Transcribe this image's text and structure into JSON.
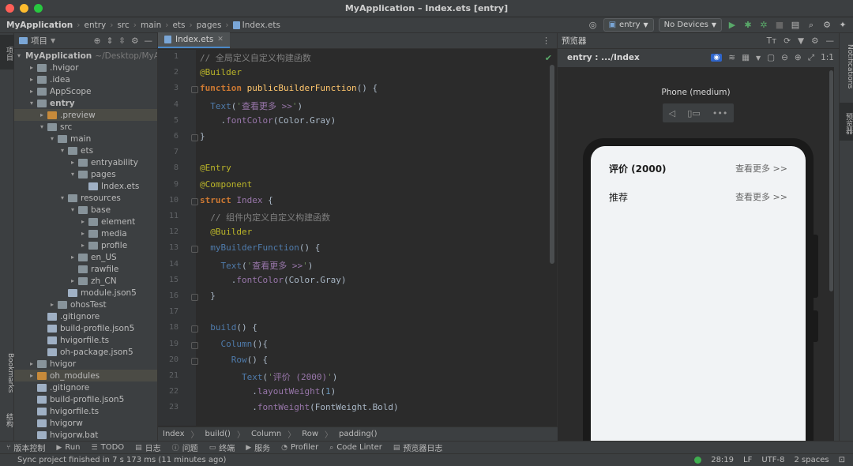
{
  "window": {
    "title": "MyApplication – Index.ets [entry]"
  },
  "navbar": {
    "breadcrumbs": [
      "MyApplication",
      "entry",
      "src",
      "main",
      "ets",
      "pages",
      "Index.ets"
    ],
    "module_combo": "entry",
    "device_combo": "No Devices"
  },
  "left_strip": {
    "project_tab": "项目",
    "bookmarks_tab": "Bookmarks",
    "structure_tab": "结构"
  },
  "project": {
    "title": "项目",
    "tree": [
      {
        "label": "MyApplication",
        "hint": "~/Desktop/MyA",
        "depth": 0,
        "expanded": true,
        "type": "folder",
        "bold": true
      },
      {
        "label": ".hvigor",
        "depth": 1,
        "expanded": false,
        "type": "folder"
      },
      {
        "label": ".idea",
        "depth": 1,
        "expanded": false,
        "type": "folder"
      },
      {
        "label": "AppScope",
        "depth": 1,
        "expanded": false,
        "type": "folder"
      },
      {
        "label": "entry",
        "depth": 1,
        "expanded": true,
        "type": "folder",
        "bold": true
      },
      {
        "label": ".preview",
        "depth": 2,
        "expanded": false,
        "type": "folder-orange",
        "selected": true
      },
      {
        "label": "src",
        "depth": 2,
        "expanded": true,
        "type": "folder"
      },
      {
        "label": "main",
        "depth": 3,
        "expanded": true,
        "type": "folder"
      },
      {
        "label": "ets",
        "depth": 4,
        "expanded": true,
        "type": "folder"
      },
      {
        "label": "entryability",
        "depth": 5,
        "expanded": false,
        "type": "folder"
      },
      {
        "label": "pages",
        "depth": 5,
        "expanded": true,
        "type": "folder"
      },
      {
        "label": "Index.ets",
        "depth": 6,
        "type": "file"
      },
      {
        "label": "resources",
        "depth": 4,
        "expanded": true,
        "type": "folder"
      },
      {
        "label": "base",
        "depth": 5,
        "expanded": true,
        "type": "folder"
      },
      {
        "label": "element",
        "depth": 6,
        "expanded": false,
        "type": "folder"
      },
      {
        "label": "media",
        "depth": 6,
        "expanded": false,
        "type": "folder"
      },
      {
        "label": "profile",
        "depth": 6,
        "expanded": false,
        "type": "folder"
      },
      {
        "label": "en_US",
        "depth": 5,
        "expanded": false,
        "type": "folder"
      },
      {
        "label": "rawfile",
        "depth": 5,
        "type": "folder"
      },
      {
        "label": "zh_CN",
        "depth": 5,
        "expanded": false,
        "type": "folder"
      },
      {
        "label": "module.json5",
        "depth": 4,
        "type": "file"
      },
      {
        "label": "ohosTest",
        "depth": 3,
        "expanded": false,
        "type": "folder"
      },
      {
        "label": ".gitignore",
        "depth": 2,
        "type": "file"
      },
      {
        "label": "build-profile.json5",
        "depth": 2,
        "type": "file"
      },
      {
        "label": "hvigorfile.ts",
        "depth": 2,
        "type": "file"
      },
      {
        "label": "oh-package.json5",
        "depth": 2,
        "type": "file"
      },
      {
        "label": "hvigor",
        "depth": 1,
        "expanded": false,
        "type": "folder"
      },
      {
        "label": "oh_modules",
        "depth": 1,
        "expanded": false,
        "type": "folder-orange",
        "selected": true
      },
      {
        "label": ".gitignore",
        "depth": 1,
        "type": "file"
      },
      {
        "label": "build-profile.json5",
        "depth": 1,
        "type": "file"
      },
      {
        "label": "hvigorfile.ts",
        "depth": 1,
        "type": "file"
      },
      {
        "label": "hvigorw",
        "depth": 1,
        "type": "file"
      },
      {
        "label": "hvigorw.bat",
        "depth": 1,
        "type": "file"
      }
    ]
  },
  "editor": {
    "tab_label": "Index.ets",
    "lines": [
      [
        [
          "cm",
          "// 全局定义自定义构建函数"
        ]
      ],
      [
        [
          "an",
          "@Builder"
        ]
      ],
      [
        [
          "kw",
          "function "
        ],
        [
          "fn",
          "publicBuilderFunction"
        ],
        [
          "tx",
          "() {"
        ]
      ],
      [
        [
          "tx",
          "  "
        ],
        [
          "id",
          "Text"
        ],
        [
          "tx",
          "("
        ],
        [
          "st",
          "'"
        ],
        [
          "mth",
          "查看更多 >>"
        ],
        [
          "st",
          "'"
        ],
        [
          "tx",
          ")"
        ]
      ],
      [
        [
          "tx",
          "    ."
        ],
        [
          "mth",
          "fontColor"
        ],
        [
          "tx",
          "(Color.Gray)"
        ]
      ],
      [
        [
          "tx",
          "}"
        ]
      ],
      [
        [
          "tx",
          ""
        ]
      ],
      [
        [
          "an",
          "@Entry"
        ]
      ],
      [
        [
          "an",
          "@Component"
        ]
      ],
      [
        [
          "kw",
          "struct "
        ],
        [
          "cls",
          "Index"
        ],
        [
          "tx",
          " {"
        ]
      ],
      [
        [
          "cm",
          "  // 组件内定义自定义构建函数"
        ]
      ],
      [
        [
          "an",
          "  @Builder"
        ]
      ],
      [
        [
          "tx",
          "  "
        ],
        [
          "id",
          "myBuilderFunction"
        ],
        [
          "tx",
          "() {"
        ]
      ],
      [
        [
          "tx",
          "    "
        ],
        [
          "id",
          "Text"
        ],
        [
          "tx",
          "("
        ],
        [
          "st",
          "'"
        ],
        [
          "mth",
          "查看更多 >>"
        ],
        [
          "st",
          "'"
        ],
        [
          "tx",
          ")"
        ]
      ],
      [
        [
          "tx",
          "      ."
        ],
        [
          "mth",
          "fontColor"
        ],
        [
          "tx",
          "(Color.Gray)"
        ]
      ],
      [
        [
          "tx",
          "  }"
        ]
      ],
      [
        [
          "tx",
          ""
        ]
      ],
      [
        [
          "tx",
          "  "
        ],
        [
          "id",
          "build"
        ],
        [
          "tx",
          "() {"
        ]
      ],
      [
        [
          "tx",
          "    "
        ],
        [
          "id",
          "Column"
        ],
        [
          "tx",
          "(){"
        ]
      ],
      [
        [
          "tx",
          "      "
        ],
        [
          "id",
          "Row"
        ],
        [
          "tx",
          "() {"
        ]
      ],
      [
        [
          "tx",
          "        "
        ],
        [
          "id",
          "Text"
        ],
        [
          "tx",
          "("
        ],
        [
          "st",
          "'"
        ],
        [
          "mth",
          "评价 (2000)"
        ],
        [
          "st",
          "'"
        ],
        [
          "tx",
          ")"
        ]
      ],
      [
        [
          "tx",
          "          ."
        ],
        [
          "mth",
          "layoutWeight"
        ],
        [
          "tx",
          "("
        ],
        [
          "nm",
          "1"
        ],
        [
          "tx",
          ")"
        ]
      ],
      [
        [
          "tx",
          "          ."
        ],
        [
          "mth",
          "fontWeight"
        ],
        [
          "tx",
          "(FontWeight.Bold)"
        ]
      ]
    ],
    "breadcrumb": [
      "Index",
      "build()",
      "Column",
      "Row",
      "padding()"
    ]
  },
  "preview": {
    "title": "预览器",
    "path": "entry : .../Index",
    "device_label": "Phone (medium)",
    "screen_rows": [
      {
        "left": "评价 (2000)",
        "right": "查看更多 >>",
        "bold": true
      },
      {
        "left": "推荐",
        "right": "查看更多 >>",
        "bold": false
      }
    ]
  },
  "right_strip": {
    "notifications_tab": "Notifications",
    "previewer_tab": "预览器"
  },
  "toolbar": {
    "items": [
      "版本控制",
      "Run",
      "TODO",
      "日志",
      "问题",
      "终端",
      "服务",
      "Profiler",
      "Code Linter",
      "预览器日志"
    ]
  },
  "status": {
    "message": "Sync project finished in 7 s 173 ms (11 minutes ago)",
    "position": "28:19",
    "line_sep": "LF",
    "encoding": "UTF-8",
    "indent": "2 spaces"
  },
  "colors": {
    "accent": "#4a88c7",
    "run_green": "#59a869",
    "status_ok": "#3fae4f"
  }
}
